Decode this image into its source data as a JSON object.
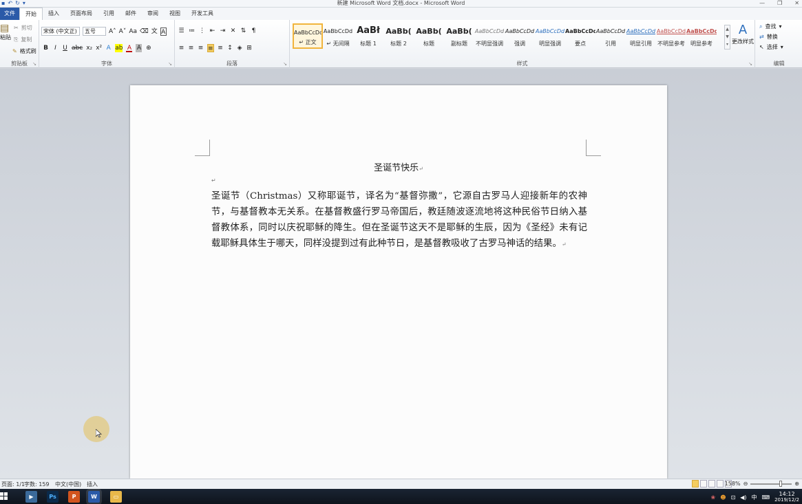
{
  "window": {
    "title": "新建 Microsoft Word 文档.docx - Microsoft Word"
  },
  "tabs": [
    "文件",
    "开始",
    "插入",
    "页面布局",
    "引用",
    "邮件",
    "审阅",
    "视图",
    "开发工具"
  ],
  "ribbon": {
    "clipboard": {
      "paste_label": "粘贴",
      "cut_label": "剪切",
      "copy_label": "复制",
      "format_painter_label": "格式刷",
      "group_label": "剪贴板"
    },
    "font": {
      "font_name": "宋体 (中文正)",
      "font_size": "五号",
      "group_label": "字体"
    },
    "paragraph": {
      "group_label": "段落"
    },
    "styles": {
      "group_label": "样式",
      "items": [
        {
          "preview": "AaBbCcDd",
          "name": "↵ 正文"
        },
        {
          "preview": "AaBbCcDd",
          "name": "↵ 无间隔"
        },
        {
          "preview": "AaBł",
          "name": "标题 1"
        },
        {
          "preview": "AaBb(",
          "name": "标题 2"
        },
        {
          "preview": "AaBb(",
          "name": "标题"
        },
        {
          "preview": "AaBb(",
          "name": "副标题"
        },
        {
          "preview": "AaBbCcDd",
          "name": "不明显强调"
        },
        {
          "preview": "AaBbCcDd",
          "name": "强调"
        },
        {
          "preview": "AaBbCcDd",
          "name": "明显强调"
        },
        {
          "preview": "AaBbCcDd",
          "name": "要点"
        },
        {
          "preview": "AaBbCcDd",
          "name": "引用"
        },
        {
          "preview": "AaBbCcDd",
          "name": "明显引用"
        },
        {
          "preview": "AaBbCcDd",
          "name": "不明显参考"
        },
        {
          "preview": "AaBbCcDd",
          "name": "明显参考"
        }
      ],
      "change_styles_label": "更改样式"
    },
    "editing": {
      "find_label": "查找",
      "replace_label": "替换",
      "select_label": "选择",
      "group_label": "编辑"
    }
  },
  "document": {
    "title": "圣诞节快乐",
    "paragraph_mark": "↵",
    "body": "圣诞节（Christmas）又称耶诞节，译名为“基督弥撒”，它源自古罗马人迎接新年的农神节，与基督教本无关系。在基督教盛行罗马帝国后，教廷随波逐流地将这种民俗节日纳入基督教体系，同时以庆祝耶稣的降生。但在圣诞节这天不是耶稣的生辰，因为《圣经》未有记载耶稣具体生于哪天，同样没提到过有此种节日，是基督教吸收了古罗马神话的结果。"
  },
  "statusbar": {
    "page": "页面: 1/1",
    "words": "字数: 159",
    "language": "中文(中国)",
    "mode": "插入",
    "zoom": "158%"
  },
  "taskbar": {
    "ime": "中",
    "time": "14:12",
    "date": "2019/12/2"
  },
  "colors": {
    "file_tab": "#2b5aa8",
    "selected_style": "#f1b43c",
    "heading_blue": "#17365d"
  }
}
